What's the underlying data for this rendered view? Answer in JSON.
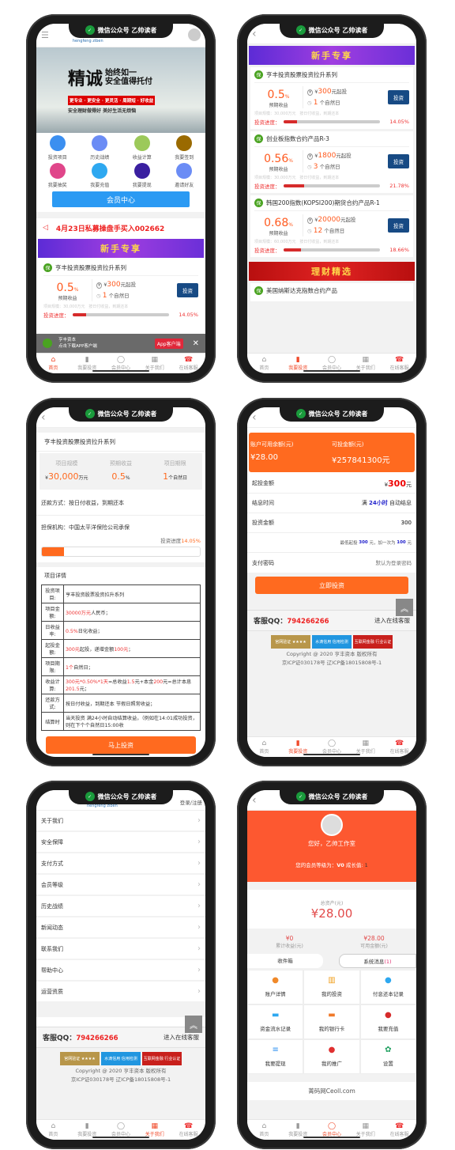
{
  "notch": {
    "label": "微信公众号 乙帅读者",
    "icon": "wechat-icon"
  },
  "nav": [
    {
      "label": "首页",
      "icon": "⌂"
    },
    {
      "label": "我要投资",
      "icon": "▮"
    },
    {
      "label": "会员中心",
      "icon": "◯"
    },
    {
      "label": "关于我们",
      "icon": "▦"
    },
    {
      "label": "在线客服",
      "icon": "☎"
    }
  ],
  "colors": {
    "accent": "#ff6a1f",
    "nav_active": "#f04a2a",
    "invest_button": "#174a84",
    "member_button": "#2b9af3"
  },
  "home": {
    "logo_text": "hengfeng ziben",
    "banner": {
      "big": "精诚",
      "line1": "始终如一",
      "line2": "安全值得托付",
      "tagline": "更专业 · 更安全 · 更灵活 · 周期短 · 好收益",
      "sub": "安全理财做得好 美好生活无烦恼"
    },
    "grid": [
      {
        "label": "投资项目",
        "color": "#3b8ff0",
        "icon": "chart-icon"
      },
      {
        "label": "历史战绩",
        "color": "#6b8cf5",
        "icon": "trophy-icon"
      },
      {
        "label": "收益计算",
        "color": "#9cc95a",
        "icon": "calculator-icon"
      },
      {
        "label": "我要签到",
        "color": "#9a6a00",
        "icon": "question-icon"
      },
      {
        "label": "我要抽奖",
        "color": "#e0468a",
        "icon": "wheel-icon"
      },
      {
        "label": "我要充值",
        "color": "#2ea8f0",
        "icon": "recharge-icon"
      },
      {
        "label": "我要提现",
        "color": "#3a1fa0",
        "icon": "wallet-icon"
      },
      {
        "label": "邀请好友",
        "color": "#6b8cf5",
        "icon": "invite-icon"
      }
    ],
    "member_button": "会员中心",
    "notice": "4月23日私募操盘手买入002662",
    "promo": "新手专享",
    "download": {
      "name": "亨丰资本",
      "sub": "点击下载APP客户端",
      "button": "App客户端",
      "close": "✕"
    }
  },
  "products": [
    {
      "title": "亨丰投资股票投资拉升系列",
      "rate": "0.5",
      "unit": "%",
      "rate_label": "预期收益",
      "min": "300",
      "min_suffix": "元起投",
      "days": "1",
      "days_suffix": "个自然日",
      "scale": "项目规模：30,000万元",
      "repay": "按日付收益，到期还本",
      "progress_label": "投资进度：",
      "progress": 14.05,
      "progress_text": "14.05%",
      "button": "投资"
    },
    {
      "title": "创业板指数合约产品R-3",
      "rate": "0.56",
      "unit": "%",
      "rate_label": "预期收益",
      "min": "1800",
      "min_suffix": "元起投",
      "days": "3",
      "days_suffix": "个自然日",
      "scale": "项目规模：30,000万元",
      "repay": "按日付收益，到期还本",
      "progress_label": "投资进度：",
      "progress": 21.78,
      "progress_text": "21.78%",
      "button": "投资"
    },
    {
      "title": "韩国200指数(KOPSI200)期货合约产品R-1",
      "rate": "0.68",
      "unit": "%",
      "rate_label": "预期收益",
      "min": "20000",
      "min_suffix": "元起投",
      "days": "12",
      "days_suffix": "个自然日",
      "scale": "项目规模：60,000万元",
      "repay": "按日付收益，到期还本",
      "progress_label": "投资进度：",
      "progress": 18.66,
      "progress_text": "18.66%",
      "button": "投资"
    }
  ],
  "list": {
    "promo": "新手专享",
    "promo2": "理财精选",
    "next_title": "美国纳斯达克指数合约产品"
  },
  "detail": {
    "title": "亨丰投资股票投资拉升系列",
    "stats": [
      {
        "label": "项目规模",
        "prefix": "¥",
        "value": "30,000",
        "unit": "万元"
      },
      {
        "label": "预期收益",
        "prefix": "",
        "value": "0.5",
        "unit": "%"
      },
      {
        "label": "项目期限",
        "prefix": "",
        "value": "1",
        "unit": "个自然日"
      }
    ],
    "repay": "还款方式：按日付收益，到期还本",
    "guarantee": "担保机构：中国太平洋保险公司承保",
    "progress_label": "投资进度",
    "progress": 14.05,
    "progress_text": "14.05%",
    "section": "项目详情",
    "rows": [
      {
        "k": "投资项目:",
        "v": [
          [
            "亨丰投资股票投资拉升系列",
            ""
          ]
        ]
      },
      {
        "k": "项目金额:",
        "v": [
          [
            "30000万元",
            "r"
          ],
          [
            "人民币；",
            ""
          ]
        ]
      },
      {
        "k": "日收益率:",
        "v": [
          [
            "0.5%",
            "r"
          ],
          [
            "日化收益；",
            ""
          ]
        ]
      },
      {
        "k": "起投金额:",
        "v": [
          [
            "300元",
            "r"
          ],
          [
            "起投，递增金额",
            ""
          ],
          [
            "100元",
            "r"
          ],
          [
            "；",
            ""
          ]
        ]
      },
      {
        "k": "项目期限:",
        "v": [
          [
            "1个",
            "r"
          ],
          [
            "自然日；",
            ""
          ]
        ]
      },
      {
        "k": "收益计算:",
        "v": [
          [
            "300元*0.50%*1天",
            "r"
          ],
          [
            "=总收益",
            ""
          ],
          [
            "1.5",
            "r"
          ],
          [
            "元+本金",
            ""
          ],
          [
            "200",
            "r"
          ],
          [
            "元=总计本息",
            ""
          ],
          [
            "201.5",
            "r"
          ],
          [
            "元；",
            ""
          ]
        ]
      },
      {
        "k": "还款方式:",
        "v": [
          [
            "按日付收益，到期还本 节假日照常收益；",
            ""
          ]
        ]
      },
      {
        "k": "结算时",
        "v": [
          [
            "当天投资 满24小时自动结算收益，（例如在14:01成功投资，则在下个个自然日15:00收",
            ""
          ]
        ]
      }
    ],
    "button": "马上投资"
  },
  "invest": {
    "balance_label": "账户可用余额(元)",
    "balance": "¥28.00",
    "available_label": "可投金额(元)",
    "available": "¥257841300元",
    "min_label": "起投金额",
    "min_prefix": "¥",
    "min_value": "300",
    "min_unit": "元",
    "interest_label": "结息时间",
    "interest_pre": "满",
    "interest_value": "24小时",
    "interest_post": "自动结息",
    "amount_label": "投资金额",
    "amount_value": "300",
    "hint_pre": "最低起投",
    "hint_min": "300",
    "hint_mid": "元，加一次为",
    "hint_step": "100",
    "hint_post": "元",
    "pwd_label": "支付密码",
    "pwd_placeholder": "默认为登录密码",
    "button": "立即投资"
  },
  "footer": {
    "qq_label": "客服QQ：",
    "qq": "794266266",
    "online": "进入在线客服",
    "badges": [
      "官网验证 ★★★★",
      "水滴信用 信用检测",
      "互联网金融 行业认证"
    ],
    "copyright": "Copyright @ 2020 亨丰资本 版权所有",
    "icp": "京ICP证030178号 辽ICP备18015808号-1",
    "totop": "︽"
  },
  "about": {
    "login": "登录/注册",
    "items": [
      "关于我们",
      "安全保障",
      "支付方式",
      "会员等级",
      "历史战绩",
      "新闻动态",
      "联系我们",
      "帮助中心",
      "运营资质"
    ]
  },
  "member": {
    "greeting": "您好，乙帅工作室",
    "level_pre": "您的会员等级为：",
    "level": "V0",
    "growth_label": "成长值:",
    "growth": "1",
    "total_label": "总资产(元)",
    "total": "¥28.00",
    "earn": "¥0",
    "earn_label": "累计收益(元)",
    "avail": "¥28.00",
    "avail_label": "可用金额(元)",
    "inbox": "收件箱",
    "sysmsg": "系统消息",
    "sysmsg_count": "(1)",
    "grid": [
      {
        "label": "账户详情",
        "color": "#f0892a",
        "icon": "money-bag-icon",
        "g": "●"
      },
      {
        "label": "我的投资",
        "color": "#f0a020",
        "icon": "bar-chart-icon",
        "g": "▥"
      },
      {
        "label": "付息还本记录",
        "color": "#2ea8f0",
        "icon": "cloud-icon",
        "g": "●"
      },
      {
        "label": "资金流水记录",
        "color": "#2ea8f0",
        "icon": "book-icon",
        "g": "▬"
      },
      {
        "label": "我的银行卡",
        "color": "#f07a2a",
        "icon": "card-icon",
        "g": "▬"
      },
      {
        "label": "我要充值",
        "color": "#d62b2b",
        "icon": "recharge-icon",
        "g": "●"
      },
      {
        "label": "我要提现",
        "color": "#2e90f0",
        "icon": "withdraw-icon",
        "g": "≡"
      },
      {
        "label": "我的推广",
        "color": "#e03030",
        "icon": "piggy-icon",
        "g": "●"
      },
      {
        "label": "设置",
        "color": "#20a060",
        "icon": "settings-icon",
        "g": "✿"
      }
    ],
    "site": "菁码网Ceoll.com"
  }
}
